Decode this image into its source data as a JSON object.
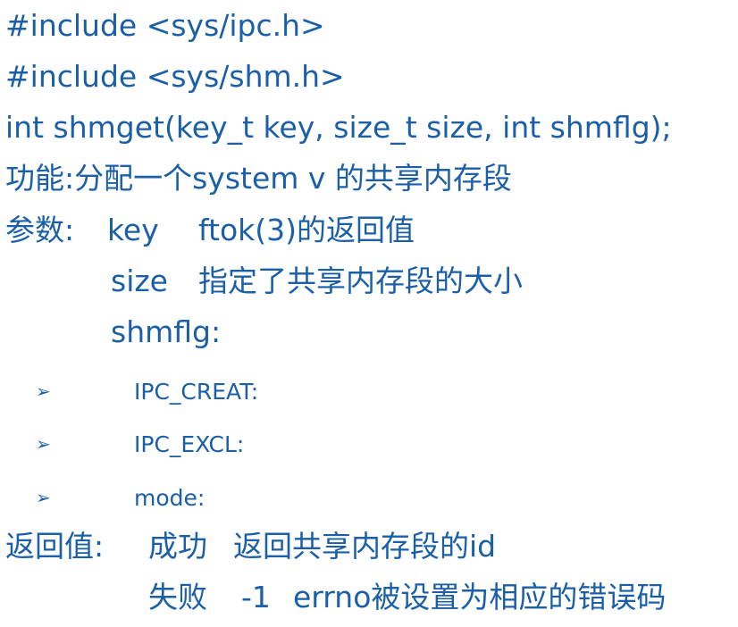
{
  "lines": {
    "include_ipc": "#include <sys/ipc.h>",
    "include_shm": "#include <sys/shm.h>",
    "prototype": "int shmget(key_t key, size_t size, int shmflg);",
    "function_label": "功能:分配一个system v 的共享内存段",
    "params_label": "参数:",
    "param_key_name": "key",
    "param_key_desc": "ftok(3)的返回值",
    "param_size_name": "size",
    "param_size_desc": "指定了共享内存段的大小",
    "param_shmflg_name": "shmflg:",
    "flags": [
      "IPC_CREAT:",
      "IPC_EXCL:",
      "mode:"
    ],
    "return_label": "返回值:",
    "success_label": "成功",
    "success_desc": "返回共享内存段的id",
    "failure_label": "失败",
    "failure_code": "-1",
    "failure_desc": "errno被设置为相应的错误码"
  },
  "bullet_icon": "arrow-bullet-icon",
  "colors": {
    "text": "#1a5fa8",
    "background": "#ffffff"
  }
}
